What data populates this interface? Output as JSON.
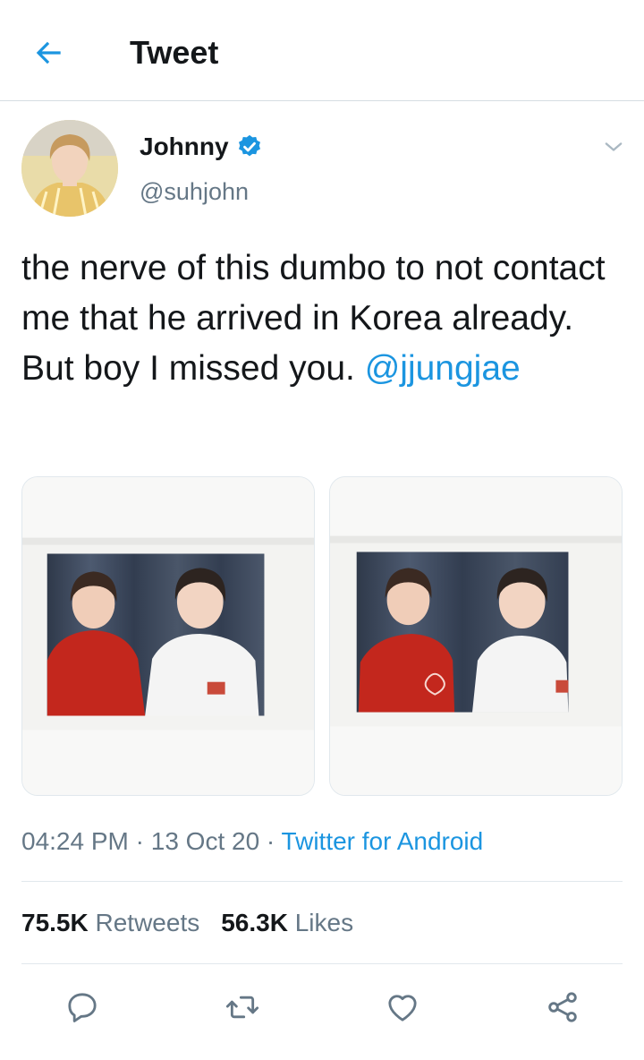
{
  "header": {
    "title": "Tweet",
    "back_icon": "arrow-left-icon"
  },
  "colors": {
    "accent": "#1b95e0",
    "text": "#14171a",
    "muted": "#657786",
    "divider": "#e1e8ed"
  },
  "tweet": {
    "author_name": "Johnny",
    "handle": "@suhjohn",
    "verified": true,
    "text": "the nerve of this dumbo to not contact me that he arrived in Korea already. But boy I missed you. ",
    "mention": "@jjungjae",
    "time": "04:24 PM",
    "date": "13 Oct 20",
    "separator": " · ",
    "source": "Twitter for Android",
    "retweets_count": "75.5K",
    "retweets_label": "Retweets",
    "likes_count": "56.3K",
    "likes_label": "Likes"
  },
  "actions": [
    "reply-icon",
    "retweet-icon",
    "like-icon",
    "share-icon"
  ]
}
